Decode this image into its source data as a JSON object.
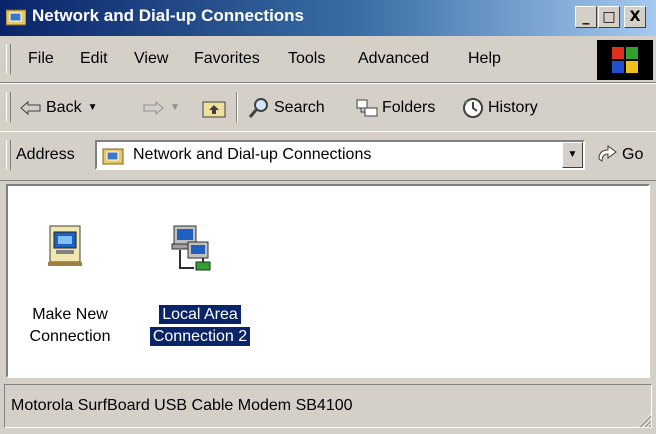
{
  "window": {
    "title": "Network and Dial-up Connections",
    "caption_buttons": [
      "_",
      "□",
      "X"
    ]
  },
  "menubar": {
    "items": [
      "File",
      "Edit",
      "View",
      "Favorites",
      "Tools",
      "Advanced",
      "Help"
    ]
  },
  "toolbar": {
    "back_label": "Back",
    "search_label": "Search",
    "folders_label": "Folders",
    "history_label": "History"
  },
  "address": {
    "label": "Address",
    "value": "Network and Dial-up Connections",
    "go_label": "Go"
  },
  "items": [
    {
      "line1": "Make New",
      "line2": "Connection",
      "selected": false
    },
    {
      "line1": "Local Area",
      "line2": "Connection 2",
      "selected": true
    }
  ],
  "status": {
    "text": "Motorola SurfBoard USB Cable Modem SB4100"
  },
  "colors": {
    "titlebar_start": "#0a246a",
    "titlebar_end": "#a6caf0",
    "selection": "#0a246a",
    "face": "#d4d0c8"
  }
}
